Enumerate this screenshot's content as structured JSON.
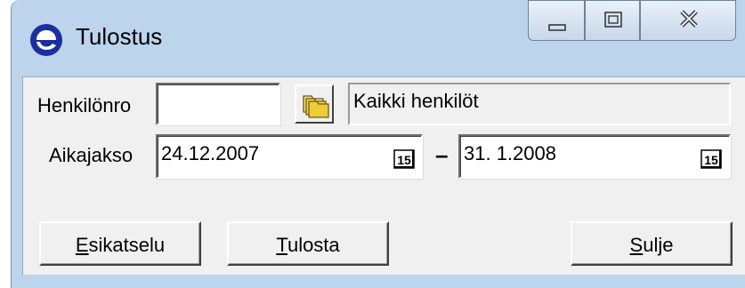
{
  "window": {
    "title": "Tulostus"
  },
  "caption": {
    "minimize_icon": "minimize-icon",
    "maximize_icon": "maximize-icon",
    "close_icon": "close-icon"
  },
  "form": {
    "henkilonro_label": "Henkilönro",
    "henkilonro_value": "",
    "person_display": "Kaikki henkilöt",
    "aikajakso_label": "Aikajakso",
    "date_from": "24.12.2007",
    "date_separator": "–",
    "date_to": "31. 1.2008",
    "calendar_icon_text": "15"
  },
  "buttons": {
    "preview_first": "E",
    "preview_rest": "sikatselu",
    "print_first": "T",
    "print_rest": "ulosta",
    "close_first": "S",
    "close_rest": "ulje"
  },
  "colors": {
    "titlebar": "#bcd4ec",
    "client": "#f0f0f0",
    "icon_blue": "#1a2fa0"
  }
}
